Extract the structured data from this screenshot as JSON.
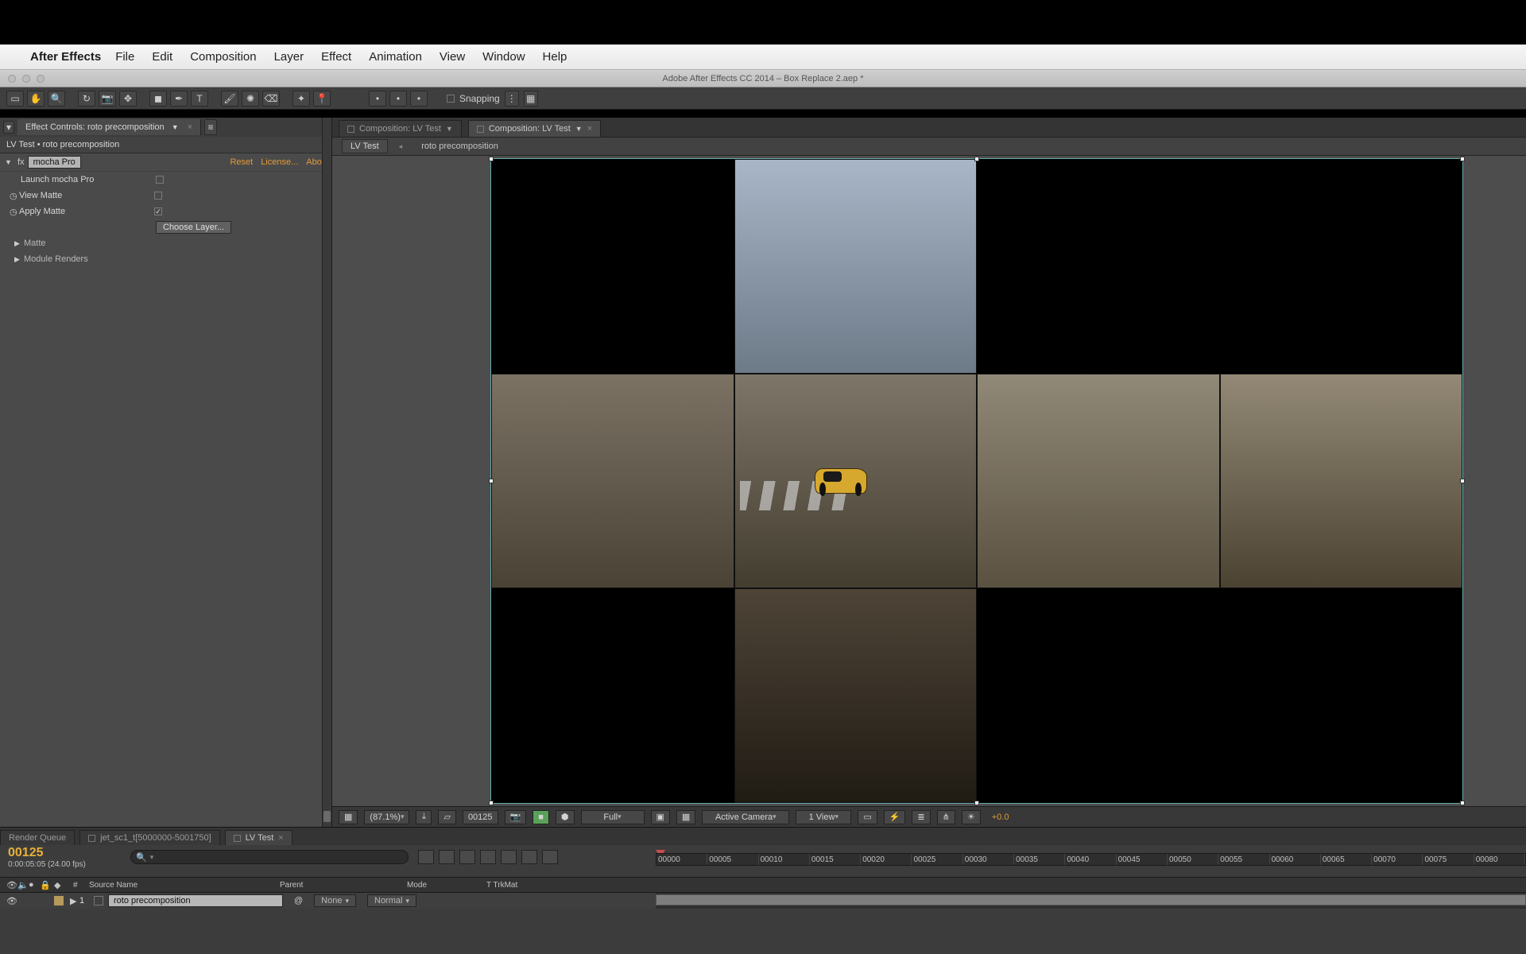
{
  "os": {
    "app_name": "After Effects",
    "menu": [
      "File",
      "Edit",
      "Composition",
      "Layer",
      "Effect",
      "Animation",
      "View",
      "Window",
      "Help"
    ],
    "window_title": "Adobe After Effects CC 2014 – Box Replace 2.aep *"
  },
  "toolbar": {
    "snapping_label": "Snapping"
  },
  "effect_controls": {
    "tab_title": "Effect Controls: roto precomposition",
    "subtitle": "LV Test • roto precomposition",
    "fx_name": "mocha Pro",
    "actions": {
      "reset": "Reset",
      "license": "License...",
      "about": "Abou"
    },
    "props": {
      "launch": "Launch mocha Pro",
      "view_matte": "View Matte",
      "apply_matte": "Apply Matte",
      "choose_layer": "Choose Layer..."
    },
    "groups": [
      "Matte",
      "Module Renders"
    ]
  },
  "composition": {
    "tabs": [
      {
        "label": "Composition: LV Test",
        "active": false
      },
      {
        "label": "Composition: LV Test",
        "active": true
      }
    ],
    "breadcrumb": [
      "LV Test",
      "roto precomposition"
    ]
  },
  "viewer_footer": {
    "zoom": "(87.1%)",
    "frame": "00125",
    "resolution": "Full",
    "camera": "Active Camera",
    "views": "1 View",
    "exposure": "+0.0"
  },
  "timeline": {
    "tabs": [
      "Render Queue",
      "jet_sc1_t[5000000-5001750]",
      "LV Test"
    ],
    "time_big": "00125",
    "time_small": "0:00:05:05 (24.00 fps)",
    "columns": {
      "num": "#",
      "src": "Source Name",
      "parent": "Parent",
      "mode": "Mode",
      "trkmat": "T  TrkMat"
    },
    "layer": {
      "index": "1",
      "name": "roto precomposition",
      "parent_value": "None",
      "mode_value": "Normal"
    },
    "ruler": [
      "00000",
      "00005",
      "00010",
      "00015",
      "00020",
      "00025",
      "00030",
      "00035",
      "00040",
      "00045",
      "00050",
      "00055",
      "00060",
      "00065",
      "00070",
      "00075",
      "00080"
    ]
  }
}
